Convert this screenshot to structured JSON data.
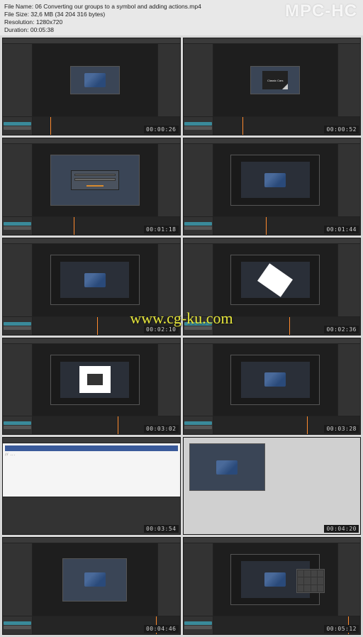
{
  "header": {
    "file_name_label": "File Name:",
    "file_name": "06 Converting our groups to a symbol and adding actions.mp4",
    "file_size_label": "File Size:",
    "file_size": "32,6 MB (34 204 316 bytes)",
    "resolution_label": "Resolution:",
    "resolution": "1280x720",
    "duration_label": "Duration:",
    "duration": "00:05:38",
    "brand": "MPC-HC"
  },
  "watermark": "www.cg-ku.com",
  "car_text": "Classic Cars",
  "thumbs": [
    {
      "timecode": "00:00:26",
      "kind": "stage-car",
      "playhead": 12
    },
    {
      "timecode": "00:00:52",
      "kind": "stage-caption",
      "playhead": 20
    },
    {
      "timecode": "00:01:18",
      "kind": "dialog",
      "playhead": 28
    },
    {
      "timecode": "00:01:44",
      "kind": "nested-car",
      "playhead": 36
    },
    {
      "timecode": "00:02:10",
      "kind": "nested-car",
      "playhead": 44
    },
    {
      "timecode": "00:02:36",
      "kind": "rotated",
      "playhead": 52
    },
    {
      "timecode": "00:03:02",
      "kind": "white-square",
      "playhead": 58
    },
    {
      "timecode": "00:03:28",
      "kind": "nested-car",
      "playhead": 64
    },
    {
      "timecode": "00:03:54",
      "kind": "code",
      "playhead": 70
    },
    {
      "timecode": "00:04:20",
      "kind": "simple",
      "playhead": 76
    },
    {
      "timecode": "00:04:46",
      "kind": "stage-car-small",
      "playhead": 84
    },
    {
      "timecode": "00:05:12",
      "kind": "nested-car-panel",
      "playhead": 92
    }
  ]
}
